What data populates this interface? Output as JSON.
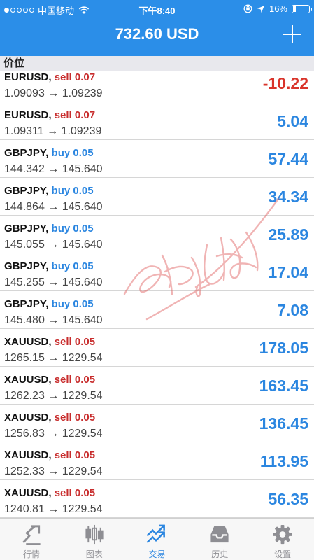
{
  "status_bar": {
    "carrier": "中国移动",
    "time": "下午8:40",
    "battery": "16%",
    "battery_level": 0.16
  },
  "header": {
    "balance": "732.60 USD"
  },
  "section": {
    "title": "价位"
  },
  "positions": [
    {
      "symbol": "EURUSD,",
      "side": "sell",
      "volume": "0.07",
      "prices": "1.09093 → 1.09239",
      "profit": "-10.22"
    },
    {
      "symbol": "EURUSD,",
      "side": "sell",
      "volume": "0.07",
      "prices": "1.09311 → 1.09239",
      "profit": "5.04"
    },
    {
      "symbol": "GBPJPY,",
      "side": "buy",
      "volume": "0.05",
      "prices": "144.342 → 145.640",
      "profit": "57.44"
    },
    {
      "symbol": "GBPJPY,",
      "side": "buy",
      "volume": "0.05",
      "prices": "144.864 → 145.640",
      "profit": "34.34"
    },
    {
      "symbol": "GBPJPY,",
      "side": "buy",
      "volume": "0.05",
      "prices": "145.055 → 145.640",
      "profit": "25.89"
    },
    {
      "symbol": "GBPJPY,",
      "side": "buy",
      "volume": "0.05",
      "prices": "145.255 → 145.640",
      "profit": "17.04"
    },
    {
      "symbol": "GBPJPY,",
      "side": "buy",
      "volume": "0.05",
      "prices": "145.480 → 145.640",
      "profit": "7.08"
    },
    {
      "symbol": "XAUUSD,",
      "side": "sell",
      "volume": "0.05",
      "prices": "1265.15 → 1229.54",
      "profit": "178.05"
    },
    {
      "symbol": "XAUUSD,",
      "side": "sell",
      "volume": "0.05",
      "prices": "1262.23 → 1229.54",
      "profit": "163.45"
    },
    {
      "symbol": "XAUUSD,",
      "side": "sell",
      "volume": "0.05",
      "prices": "1256.83 → 1229.54",
      "profit": "136.45"
    },
    {
      "symbol": "XAUUSD,",
      "side": "sell",
      "volume": "0.05",
      "prices": "1252.33 → 1229.54",
      "profit": "113.95"
    },
    {
      "symbol": "XAUUSD,",
      "side": "sell",
      "volume": "0.05",
      "prices": "1240.81 → 1229.54",
      "profit": "56.35"
    }
  ],
  "tabs": [
    {
      "label": "行情",
      "icon": "quotes-icon",
      "active": false
    },
    {
      "label": "图表",
      "icon": "chart-icon",
      "active": false
    },
    {
      "label": "交易",
      "icon": "trade-icon",
      "active": true
    },
    {
      "label": "历史",
      "icon": "history-icon",
      "active": false
    },
    {
      "label": "设置",
      "icon": "settings-icon",
      "active": false
    }
  ],
  "colors": {
    "accent": "#2b8ee8",
    "sell": "#c82d2d",
    "buy": "#2b86e0",
    "profit_positive": "#2b86e0",
    "profit_negative": "#d9342b",
    "watermark": "#e05a5a"
  }
}
